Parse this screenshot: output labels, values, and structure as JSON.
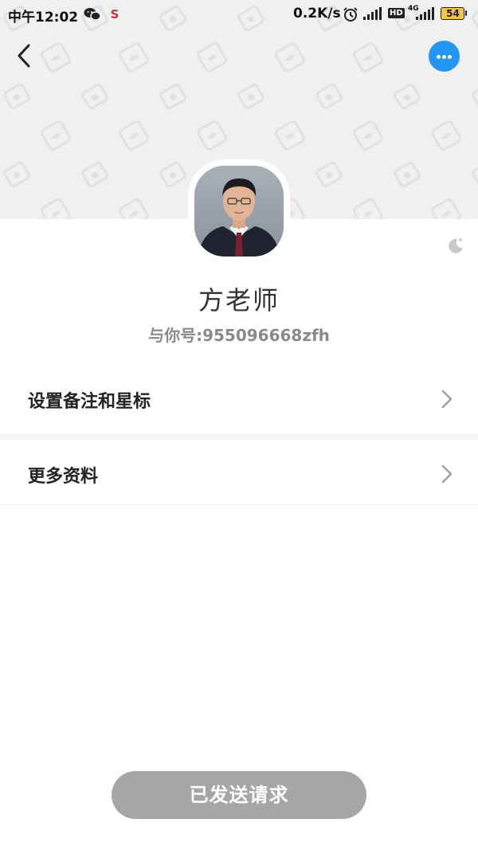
{
  "status_bar": {
    "time": "中午12:02",
    "network_speed": "0.2K/s",
    "hd": "HD",
    "network_type": "4G",
    "battery": "54",
    "icons": [
      "wechat-icon",
      "app-icon",
      "alarm-icon",
      "signal-icon",
      "signal-icon",
      "battery-icon"
    ]
  },
  "header": {
    "back_icon": "chevron-left-icon",
    "more_icon": "more-dots-icon",
    "accent_color": "#2196f3"
  },
  "profile": {
    "name": "方老师",
    "account": "与你号:955096668zfh",
    "night_icon": "moon-star-icon"
  },
  "menu": {
    "items": [
      {
        "label": "设置备注和星标",
        "icon": "chevron-right-icon"
      },
      {
        "label": "更多资料",
        "icon": "chevron-right-icon"
      }
    ]
  },
  "action": {
    "request_label": "已发送请求",
    "button_color": "#a6a6a6"
  }
}
